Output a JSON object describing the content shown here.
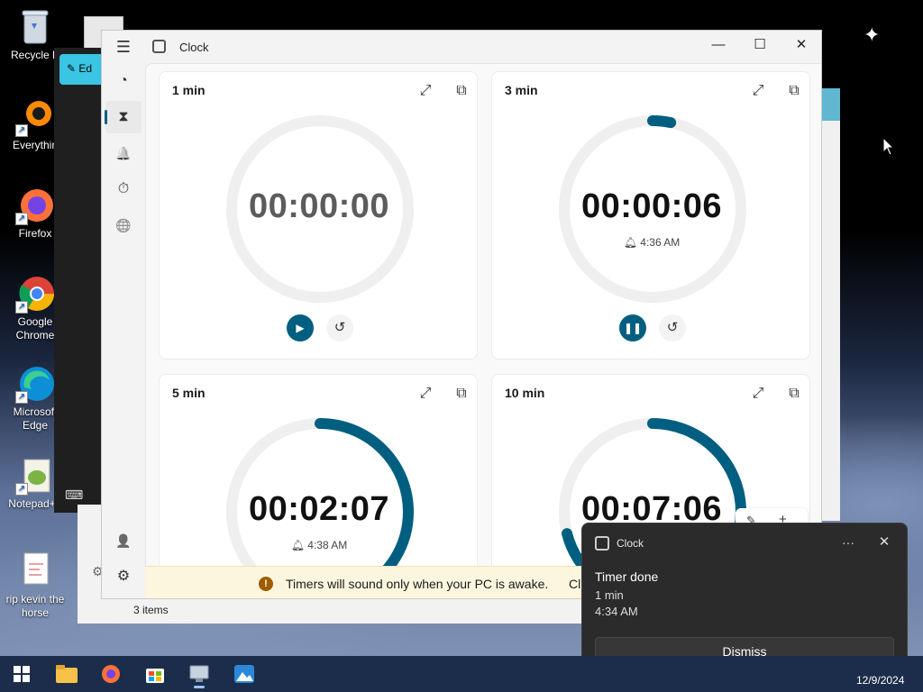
{
  "desktop": {
    "icons": [
      {
        "label": "Recycle B",
        "icon": "recycle-bin-icon"
      },
      {
        "label": "Everythin",
        "icon": "everything-search-icon"
      },
      {
        "label": "Firefox",
        "icon": "firefox-icon"
      },
      {
        "label": "Google Chrome",
        "icon": "chrome-icon"
      },
      {
        "label": "Microsoft Edge",
        "icon": "edge-icon"
      },
      {
        "label": "Notepad++",
        "icon": "notepadpp-icon"
      },
      {
        "label": "rip kevin the horse",
        "icon": "document-icon"
      }
    ],
    "edit_button_label": "Ed",
    "explorer_status": "3 items"
  },
  "clock_app": {
    "title": "Clock",
    "menu_icon": "hamburger-icon",
    "window_controls": {
      "minimize": "—",
      "maximize": "☐",
      "close": "✕"
    },
    "nav": [
      {
        "name": "focus-sessions",
        "icon": "focus-icon",
        "glyph": "◔"
      },
      {
        "name": "timer",
        "icon": "hourglass-icon",
        "glyph": "⧗",
        "active": true
      },
      {
        "name": "alarm",
        "icon": "bell-icon",
        "glyph": "🔔"
      },
      {
        "name": "stopwatch",
        "icon": "stopwatch-icon",
        "glyph": "⏱"
      },
      {
        "name": "world-clock",
        "icon": "globe-icon",
        "glyph": "🌐"
      }
    ],
    "nav_bottom": [
      {
        "name": "account",
        "icon": "person-icon",
        "glyph": "👤"
      },
      {
        "name": "settings",
        "icon": "gear-icon",
        "glyph": "⚙"
      }
    ],
    "timers": [
      {
        "name": "1 min",
        "time": "00:00:00",
        "alarm_time": "",
        "state": "idle",
        "progress": 0.0
      },
      {
        "name": "3 min",
        "time": "00:00:06",
        "alarm_time": "4:36 AM",
        "state": "running",
        "progress": 0.033
      },
      {
        "name": "5 min",
        "time": "00:02:07",
        "alarm_time": "4:38 AM",
        "state": "running",
        "progress": 0.42
      },
      {
        "name": "10 min",
        "time": "00:07:06",
        "alarm_time": "",
        "state": "running",
        "progress": 0.71
      }
    ],
    "banner": {
      "message": "Timers will sound only when your PC is awake.",
      "action": "Cl"
    }
  },
  "notification": {
    "app": "Clock",
    "title": "Timer done",
    "line1": "1 min",
    "line2": "4:34 AM",
    "dismiss_label": "Dismiss",
    "more_label": "···",
    "close_label": "✕"
  },
  "taskbar": {
    "items": [
      {
        "name": "start",
        "icon": "windows-logo-icon"
      },
      {
        "name": "file-explorer",
        "icon": "folder-icon"
      },
      {
        "name": "firefox",
        "icon": "firefox-icon"
      },
      {
        "name": "store",
        "icon": "store-icon"
      },
      {
        "name": "remote-desktop",
        "icon": "computer-icon"
      },
      {
        "name": "photos",
        "icon": "photos-icon"
      }
    ],
    "date": "12/9/2024"
  },
  "colors": {
    "accent": "#005f80",
    "banner_bg": "#fdf6de",
    "toast_bg": "#2b2b2b",
    "taskbar_bg": "#1b2d4a"
  }
}
